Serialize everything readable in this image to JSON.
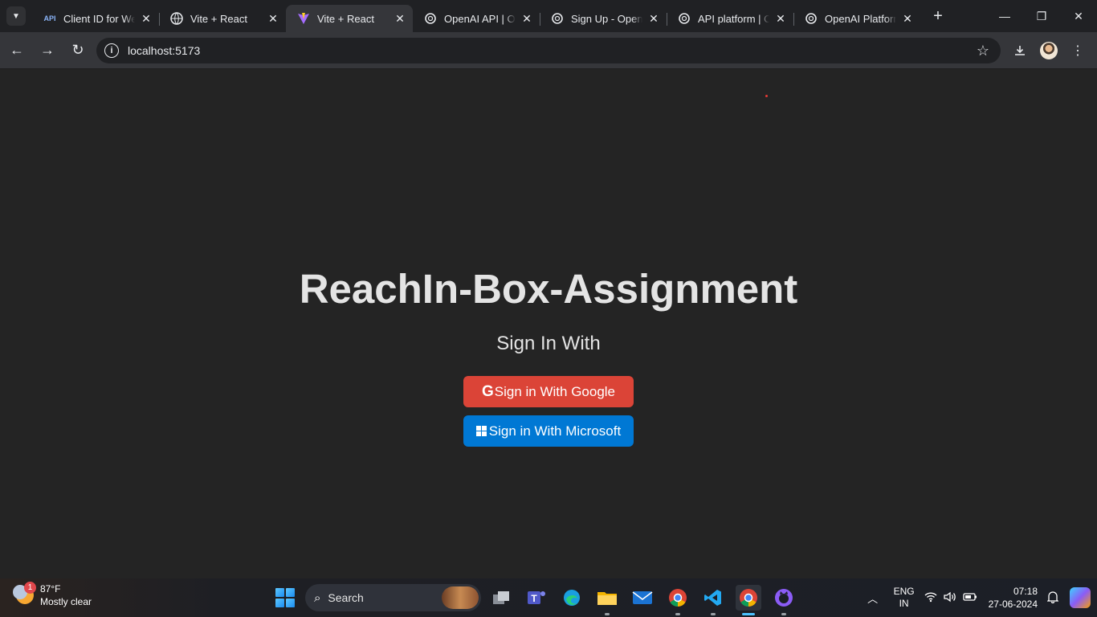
{
  "browser": {
    "tabs": [
      {
        "title": "Client ID for Web",
        "icon": "api-icon",
        "favicon_text": "API",
        "active": false
      },
      {
        "title": "Vite + React",
        "icon": "globe-icon",
        "active": false
      },
      {
        "title": "Vite + React",
        "icon": "vite-icon",
        "active": true
      },
      {
        "title": "OpenAI API | Op",
        "icon": "openai-icon",
        "active": false
      },
      {
        "title": "Sign Up - OpenA",
        "icon": "openai-icon",
        "active": false
      },
      {
        "title": "API platform | O",
        "icon": "openai-icon",
        "active": false
      },
      {
        "title": "OpenAI Platform",
        "icon": "openai-icon",
        "active": false
      }
    ],
    "address": "localhost:5173"
  },
  "page": {
    "heading": "ReachIn-Box-Assignment",
    "subheading": "Sign In With",
    "google_button": "Sign in With Google",
    "google_glyph": "G",
    "microsoft_button": "Sign in With Microsoft",
    "colors": {
      "google": "#db4437",
      "microsoft": "#0078d4",
      "background": "#242424"
    }
  },
  "taskbar": {
    "weather": {
      "temp": "87°F",
      "condition": "Mostly clear",
      "badge": "1"
    },
    "search_label": "Search",
    "apps": [
      "task-view-icon",
      "teams-icon",
      "edge-icon",
      "file-explorer-icon",
      "mail-icon",
      "chrome-icon",
      "vscode-icon",
      "chrome-icon",
      "github-icon"
    ],
    "language": {
      "line1": "ENG",
      "line2": "IN"
    },
    "time": "07:18",
    "date": "27-06-2024"
  }
}
